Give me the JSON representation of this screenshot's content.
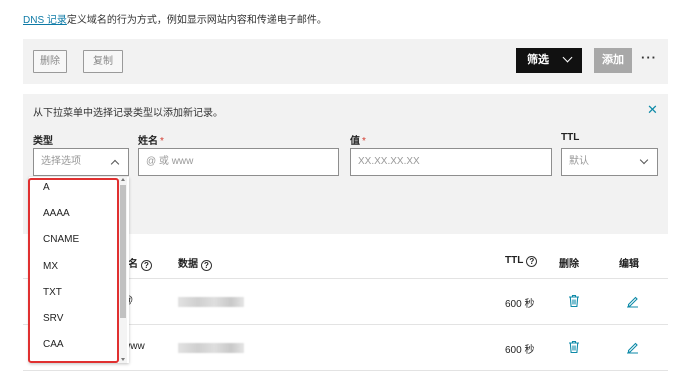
{
  "intro": {
    "link": "DNS 记录",
    "text": "定义域名的行为方式，例如显示网站内容和传递电子邮件。"
  },
  "toolbar": {
    "delete": "删除",
    "copy": "复制",
    "filter": "筛选",
    "add": "添加",
    "more": "···"
  },
  "add_panel": {
    "hint": "从下拉菜单中选择记录类型以添加新记录。",
    "close": "✕",
    "type": {
      "label": "类型",
      "placeholder": "选择选项"
    },
    "name": {
      "label": "姓名",
      "required": "*",
      "placeholder": "@ 或 www"
    },
    "value": {
      "label": "值",
      "required": "*",
      "placeholder": "XX.XX.XX.XX"
    },
    "ttl": {
      "label": "TTL",
      "placeholder": "默认"
    }
  },
  "type_dropdown": {
    "options": [
      "A",
      "AAAA",
      "CNAME",
      "MX",
      "TXT",
      "SRV",
      "CAA"
    ]
  },
  "table": {
    "headers": {
      "name": "名",
      "data": "数据",
      "ttl": "TTL",
      "delete": "删除",
      "edit": "编辑"
    },
    "help_icon": "?",
    "rows": [
      {
        "name": "@",
        "ttl": "600 秒"
      },
      {
        "name": "www",
        "ttl": "600 秒"
      }
    ]
  },
  "colors": {
    "accent": "#0e7aa6",
    "highlight": "#e03030",
    "filter_button": "#111111",
    "add_button": "#a8a8a8"
  }
}
